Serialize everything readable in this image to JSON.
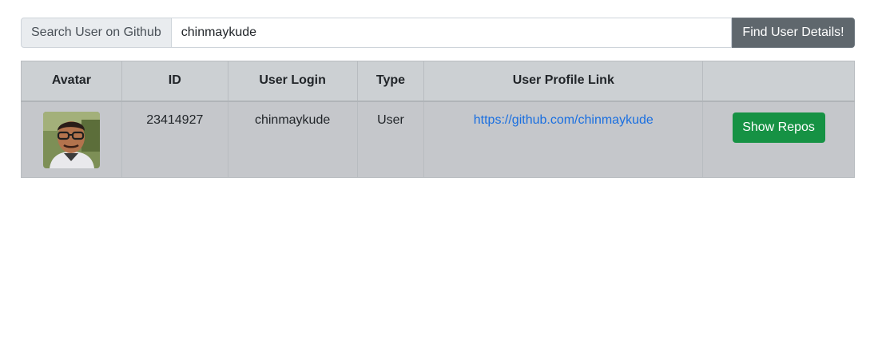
{
  "search": {
    "prepend_label": "Search User on Github",
    "value": "chinmaykude",
    "button_label": "Find User Details!"
  },
  "table": {
    "headers": [
      "Avatar",
      "ID",
      "User Login",
      "Type",
      "User Profile Link",
      ""
    ],
    "rows": [
      {
        "avatar_icon": "user-avatar-photo",
        "id": "23414927",
        "login": "chinmaykude",
        "type": "User",
        "profile_link": "https://github.com/chinmaykude",
        "action_label": "Show Repos"
      }
    ]
  },
  "colors": {
    "secondary_button": "#5f676d",
    "success_button": "#169244",
    "link": "#1a6fe0",
    "table_header_bg": "#ccd0d3",
    "table_row_bg": "#c5c7cb"
  }
}
